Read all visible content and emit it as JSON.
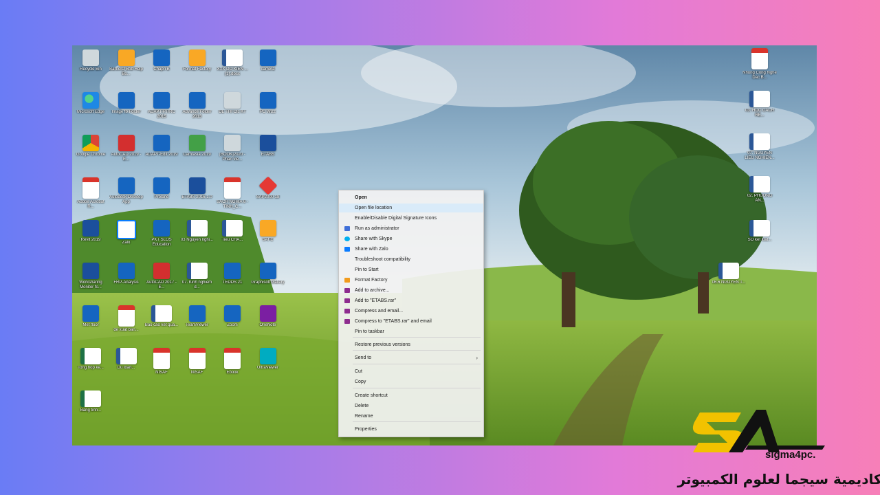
{
  "colors": {
    "background_left": "#6a7cf5",
    "background_right": "#f77fb8",
    "menu_bg": "#f2f2f2",
    "brand_yellow": "#f2c200"
  },
  "desktop": {
    "icons": [
      {
        "label": "Recycle Bin",
        "icon": "recycle-bin-icon"
      },
      {
        "label": "BarbeIO Bob Help Bo...",
        "icon": "tool-icon"
      },
      {
        "label": "Chapri B",
        "icon": "app-icon"
      },
      {
        "label": "Format Factory",
        "icon": "format-factory-icon"
      },
      {
        "label": "XXX DO KIEN ... (1).docx",
        "icon": "word-icon"
      },
      {
        "label": "camera",
        "icon": "camera-icon"
      },
      {
        "label": "Microsoft Edge",
        "icon": "edge-icon"
      },
      {
        "label": "Image to Folder",
        "icon": "app-icon"
      },
      {
        "label": "ADAPT-PT/RC 2015",
        "icon": "adapt-icon"
      },
      {
        "label": "Advance Folder 2013",
        "icon": "app-icon"
      },
      {
        "label": "DE THI Ctc KT",
        "icon": "document-icon"
      },
      {
        "label": "PC Wizz",
        "icon": "app-icon"
      },
      {
        "label": "Google Chrome",
        "icon": "chrome-icon"
      },
      {
        "label": "AutoCAD 2019 - E...",
        "icon": "autocad-icon"
      },
      {
        "label": "ADAPT-Edit 2019",
        "icon": "adapt-icon"
      },
      {
        "label": "Camtasia 2019",
        "icon": "camtasia-icon"
      },
      {
        "label": "[BOOK]2020 - Phan vie...",
        "icon": "document-icon"
      },
      {
        "label": "ETABS",
        "icon": "etabs-icon"
      },
      {
        "label": "Adobe Acrobat R...",
        "icon": "acrobat-icon"
      },
      {
        "label": "Autodesk Desktop App",
        "icon": "autodesk-icon"
      },
      {
        "label": "Prolane",
        "icon": "app-icon"
      },
      {
        "label": "ETABS 2016.1.0",
        "icon": "etabs-icon"
      },
      {
        "label": "SACH NGHIA 6 - TINH_C...",
        "icon": "pdf-icon"
      },
      {
        "label": "SAP2000 18",
        "icon": "sap-icon"
      },
      {
        "label": "Revit 2019",
        "icon": "revit-icon"
      },
      {
        "label": "Zalo",
        "icon": "zalo-icon"
      },
      {
        "label": "PKT SLOS Education",
        "icon": "app-icon"
      },
      {
        "label": "03 Nguyen nghi...",
        "icon": "word-icon"
      },
      {
        "label": "Tieu CHA...",
        "icon": "word-icon"
      },
      {
        "label": "SAFE",
        "icon": "safe-icon"
      },
      {
        "label": "Worksharing Monitor fo...",
        "icon": "revit-icon"
      },
      {
        "label": "FRP-Analysis",
        "icon": "app-icon"
      },
      {
        "label": "AutoCAD 2017 - E...",
        "icon": "autocad-icon"
      },
      {
        "label": "07. Kinh nghiem d...",
        "icon": "word-icon"
      },
      {
        "label": "TEDDS 21",
        "icon": "app-icon"
      },
      {
        "label": "Graphisoft Gallery",
        "icon": "app-icon"
      },
      {
        "label": "Met floor",
        "icon": "app-icon"
      },
      {
        "label": "de xuat ban...",
        "icon": "pdf-icon"
      },
      {
        "label": "Bao cao ket qua...",
        "icon": "word-icon"
      },
      {
        "label": "TeamViewer",
        "icon": "teamviewer-icon"
      },
      {
        "label": "Zoom",
        "icon": "zoom-icon"
      },
      {
        "label": "OneNote",
        "icon": "onenote-icon"
      },
      {
        "label": "Tong hop ke...",
        "icon": "excel-icon"
      },
      {
        "label": "Du toan...",
        "icon": "word-icon"
      },
      {
        "label": "NISAF",
        "icon": "pdf-icon"
      },
      {
        "label": "NISAF",
        "icon": "pdf-icon"
      },
      {
        "label": "Ebook",
        "icon": "pdf-icon"
      },
      {
        "label": "UltraViewer",
        "icon": "ultraviewer-icon"
      },
      {
        "label": "Bang tinh...",
        "icon": "excel-icon"
      }
    ],
    "right_icons": [
      {
        "label": "Nhung Cong Nghe Dac B...",
        "icon": "pdf-icon"
      },
      {
        "label": "03. HOC CACH RE...",
        "icon": "word-icon"
      },
      {
        "label": "07. NGUYEN LIEU NGHIEN...",
        "icon": "word-icon"
      },
      {
        "label": "02. PHUONG AN...",
        "icon": "word-icon"
      },
      {
        "label": "SO ket luat...",
        "icon": "word-icon"
      },
      {
        "label": "06.6 NGUYEN T...",
        "icon": "word-icon"
      }
    ]
  },
  "context_menu": {
    "items": [
      {
        "label": "Open",
        "icon": "",
        "bold": true
      },
      {
        "label": "Open file location",
        "icon": "",
        "highlight": true
      },
      {
        "label": "Enable/Disable Digital Signature Icons",
        "icon": ""
      },
      {
        "label": "Run as administrator",
        "icon": "shield-icon"
      },
      {
        "label": "Share with Skype",
        "icon": "skype-icon"
      },
      {
        "label": "Share with Zalo",
        "icon": "zalo-icon"
      },
      {
        "label": "Troubleshoot compatibility",
        "icon": ""
      },
      {
        "label": "Pin to Start",
        "icon": ""
      },
      {
        "label": "Format Factory",
        "icon": "format-factory-icon"
      },
      {
        "label": "Add to archive...",
        "icon": "winrar-icon"
      },
      {
        "label": "Add to \"ETABS.rar\"",
        "icon": "winrar-icon"
      },
      {
        "label": "Compress and email...",
        "icon": "winrar-icon"
      },
      {
        "label": "Compress to \"ETABS.rar\" and email",
        "icon": "winrar-icon"
      },
      {
        "label": "Pin to taskbar",
        "icon": ""
      },
      {
        "label": "Restore previous versions",
        "icon": ""
      },
      {
        "label": "Send to",
        "icon": "",
        "submenu": true
      },
      {
        "label": "Cut",
        "icon": ""
      },
      {
        "label": "Copy",
        "icon": ""
      },
      {
        "label": "Create shortcut",
        "icon": ""
      },
      {
        "label": "Delete",
        "icon": ""
      },
      {
        "label": "Rename",
        "icon": ""
      },
      {
        "label": "Properties",
        "icon": ""
      }
    ],
    "submenu_arrow": "›"
  },
  "logo": {
    "brand": "sigma4pc.",
    "arabic": "اكاديمية سيجما لعلوم الكمبيوتر",
    "mark": "SA"
  }
}
